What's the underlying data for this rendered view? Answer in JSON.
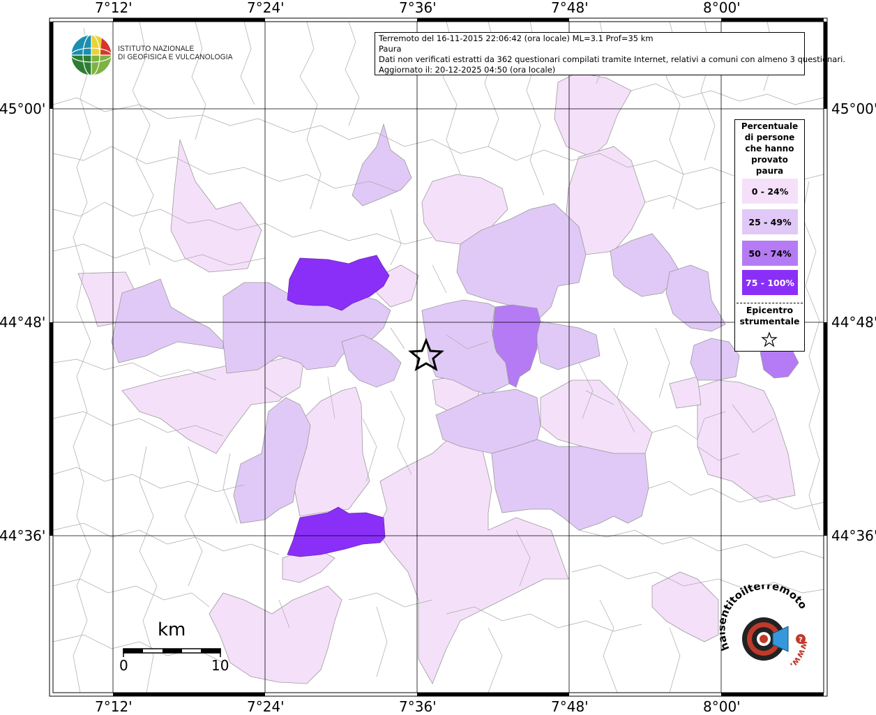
{
  "info": {
    "line1": "Terremoto del 16-11-2015 22:06:42 (ora locale) ML=3.1 Prof=35 km",
    "line2": "Paura",
    "line3": "Dati non verificati estratti da 362 questionari compilati tramite Internet, relativi a comuni con almeno 3 questionari.",
    "line4": "Aggiornato il: 20-12-2025 04:50 (ora locale)"
  },
  "ingv_logo": {
    "line1": "ISTITUTO NAZIONALE",
    "line2": "DI GEOFISICA E VULCANOLOGIA"
  },
  "axes": {
    "lon_labels": [
      "7°12'",
      "7°24'",
      "7°36'",
      "7°48'",
      "8°00'"
    ],
    "lat_labels": [
      "45°00'",
      "44°48'",
      "44°36'"
    ]
  },
  "legend": {
    "title_lines": [
      "Percentuale",
      "di persone",
      "che hanno",
      "provato",
      "paura"
    ],
    "classes": [
      {
        "label": "0 - 24%",
        "color": "#f5e0fa",
        "text_color": "#000000"
      },
      {
        "label": "25 - 49%",
        "color": "#e0c9f7",
        "text_color": "#000000"
      },
      {
        "label": "50 - 74%",
        "color": "#b57bf4",
        "text_color": "#000000"
      },
      {
        "label": "75 - 100%",
        "color": "#8a2ff7",
        "text_color": "#ffffff"
      }
    ],
    "epicenter_lines": [
      "Epicentro",
      "strumentale"
    ],
    "epicenter_icon": "star-icon"
  },
  "scale_bar": {
    "unit": "km",
    "start": "0",
    "end": "10"
  },
  "logo_hst": {
    "text": "haisentitoilterremoto.it",
    "text2": "www.",
    "icon": "megaphone-target-icon"
  }
}
